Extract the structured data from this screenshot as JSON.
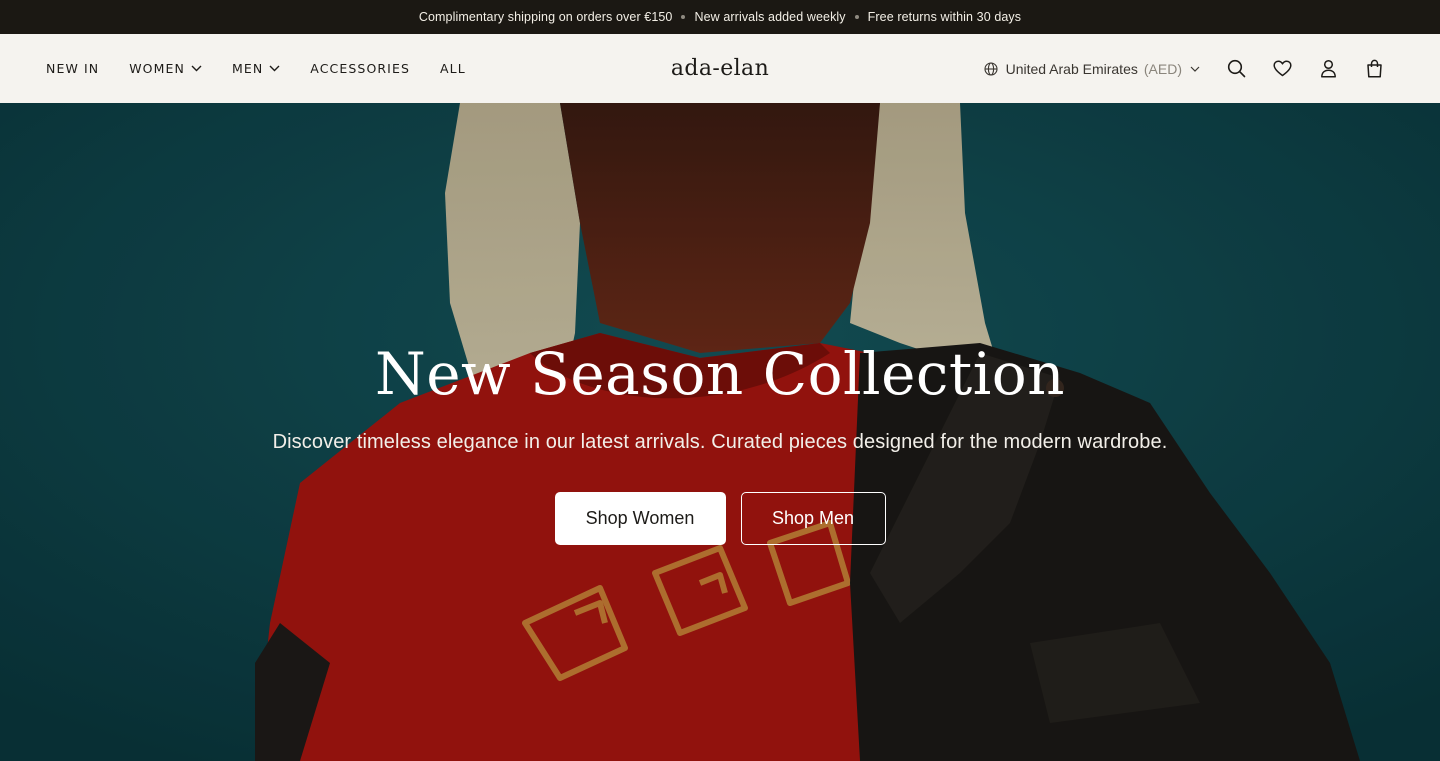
{
  "announcement": {
    "items": [
      "Complimentary shipping on orders over €150",
      "New arrivals added weekly",
      "Free returns within 30 days"
    ]
  },
  "header": {
    "nav": [
      {
        "label": "NEW IN",
        "dropdown": false
      },
      {
        "label": "WOMEN",
        "dropdown": true
      },
      {
        "label": "MEN",
        "dropdown": true
      },
      {
        "label": "ACCESSORIES",
        "dropdown": false
      },
      {
        "label": "ALL",
        "dropdown": false
      }
    ],
    "logo": "ada-elan",
    "country": {
      "name": "United Arab Emirates",
      "currency": "(AED)"
    },
    "icons": [
      "search-icon",
      "wishlist-heart-icon",
      "account-icon",
      "bag-icon"
    ]
  },
  "hero": {
    "title": "New Season Collection",
    "subtitle": "Discover timeless elegance in our latest arrivals. Curated pieces designed for the modern wardrobe.",
    "cta_primary": "Shop Women",
    "cta_secondary": "Shop Men"
  },
  "colors": {
    "announcement_bg": "#1b1813",
    "header_bg": "#f5f3ef",
    "hero_teal": "#0f4248",
    "shirt_red": "#a6150f",
    "jacket_black": "#1b1916"
  }
}
